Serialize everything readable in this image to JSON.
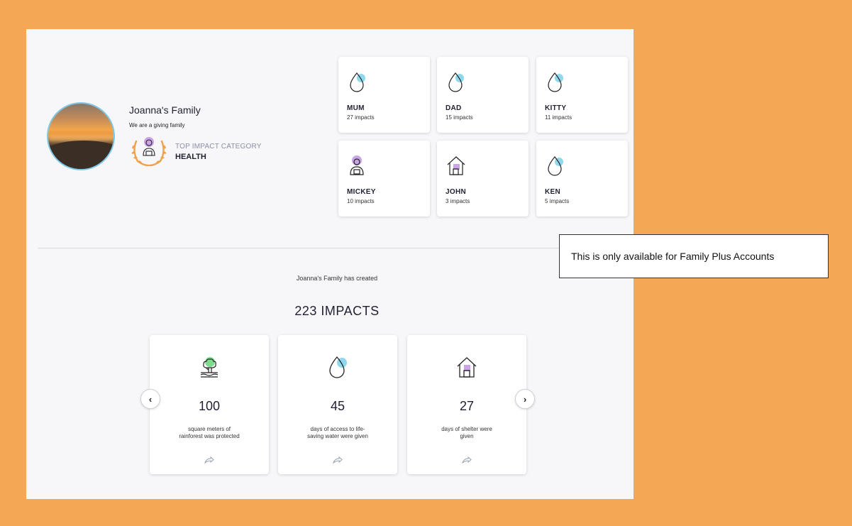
{
  "family": {
    "name": "Joanna's Family",
    "tagline": "We are a giving family",
    "top_category_label": "TOP IMPACT CATEGORY",
    "top_category_value": "HEALTH"
  },
  "members": [
    {
      "name": "MUM",
      "count": "27 impacts",
      "icon": "water-drop-icon"
    },
    {
      "name": "DAD",
      "count": "15 impacts",
      "icon": "water-drop-icon"
    },
    {
      "name": "KITTY",
      "count": "11 impacts",
      "icon": "water-drop-icon"
    },
    {
      "name": "MICKEY",
      "count": "10 impacts",
      "icon": "doctor-icon"
    },
    {
      "name": "JOHN",
      "count": "3 impacts",
      "icon": "house-icon"
    },
    {
      "name": "KEN",
      "count": "5 impacts",
      "icon": "water-drop-icon"
    }
  ],
  "summary": {
    "created_text": "Joanna's Family has created",
    "total": "223 IMPACTS"
  },
  "impacts": [
    {
      "value": "100",
      "desc1": "square meters of",
      "desc2": "rainforest was protected",
      "icon": "rainforest-icon"
    },
    {
      "value": "45",
      "desc1": "days of access to life-",
      "desc2": "saving water were given",
      "icon": "water-drop-icon"
    },
    {
      "value": "27",
      "desc1": "days of shelter were",
      "desc2": "given",
      "icon": "house-icon"
    }
  ],
  "nav": {
    "prev": "‹",
    "next": "›"
  },
  "tooltip": "This is only available for Family Plus Accounts",
  "colors": {
    "background": "#f4a855",
    "panel": "#f7f7f9",
    "drop_accent": "#8fd8ee",
    "doctor_accent": "#c9a4e6",
    "tree_accent": "#7fdc8e",
    "laurel": "#f0a24a"
  }
}
